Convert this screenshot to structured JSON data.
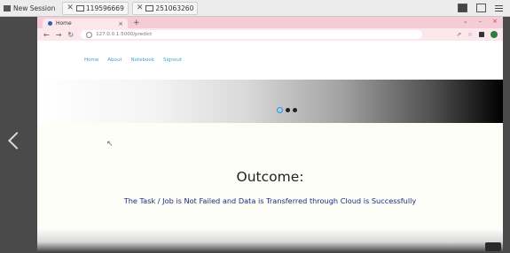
{
  "viewer": {
    "session_label": "New Session",
    "tabs": [
      {
        "label": "119596669"
      },
      {
        "label": "251063260"
      }
    ]
  },
  "browser": {
    "tab_title": "Home",
    "new_tab": "+",
    "url": "127.0.0.1:5000/predict",
    "window_controls": {
      "dropdown": "⌄",
      "minimize": "–",
      "close": "×"
    }
  },
  "site": {
    "nav": [
      "Home",
      "About",
      "Notebook",
      "Signout"
    ]
  },
  "main": {
    "outcome_title": "Outcome:",
    "outcome_message": "The Task / Job is Not Failed and Data is Transferred through Cloud is Successfully"
  },
  "colors": {
    "nav_link": "#3aa3d4",
    "message": "#1f2a7a",
    "tabstrip": "#f5cbd6"
  }
}
